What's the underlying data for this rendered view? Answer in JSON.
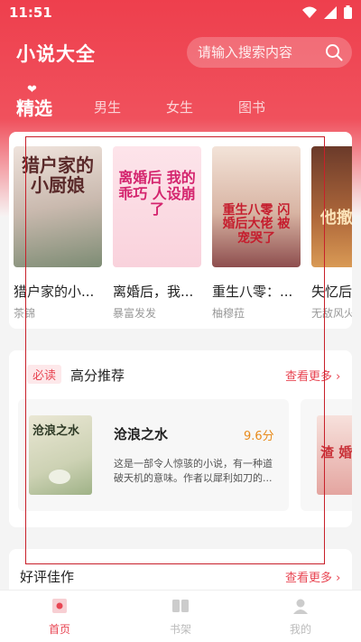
{
  "status_bar": {
    "time": "11:51"
  },
  "header": {
    "app_title": "小说大全",
    "search": {
      "placeholder": "请输入搜索内容"
    }
  },
  "tabs": [
    {
      "label": "精选",
      "active": true
    },
    {
      "label": "男生",
      "active": false
    },
    {
      "label": "女生",
      "active": false
    },
    {
      "label": "图书",
      "active": false
    }
  ],
  "carousel": {
    "books": [
      {
        "title": "猎户家的小...",
        "author": "茶锦",
        "cover_text": "猎户家的 小厨娘"
      },
      {
        "title": "离婚后，我...",
        "author": "暴富发发",
        "cover_text": "离婚后 我的乖巧 人设崩了"
      },
      {
        "title": "重生八零：...",
        "author": "柚穆菈",
        "cover_text": "重生八零 闪婚后大佬 被宠哭了"
      },
      {
        "title": "失忆后",
        "author": "无敌风火",
        "cover_text": "他撤 离婚"
      }
    ]
  },
  "recommend": {
    "badge": "必读",
    "title": "高分推荐",
    "see_more": "查看更多",
    "item": {
      "title": "沧浪之水",
      "score": "9.6分",
      "desc": "这是一部令人惊骇的小说，有一种道破天机的意味。作者以犀利如刀的...",
      "cover_text": "沧浪之水"
    },
    "peek_cover_text": "渣 婚"
  },
  "good_reviews": {
    "title": "好评佳作",
    "see_more": "查看更多"
  },
  "bottom_nav": [
    {
      "label": "首页",
      "icon": "home-icon",
      "active": true
    },
    {
      "label": "书架",
      "icon": "bookshelf-icon",
      "active": false
    },
    {
      "label": "我的",
      "icon": "profile-icon",
      "active": false
    }
  ],
  "colors": {
    "brand": "#ee3f4d",
    "accent": "#e84653",
    "score": "#e88a1a"
  }
}
